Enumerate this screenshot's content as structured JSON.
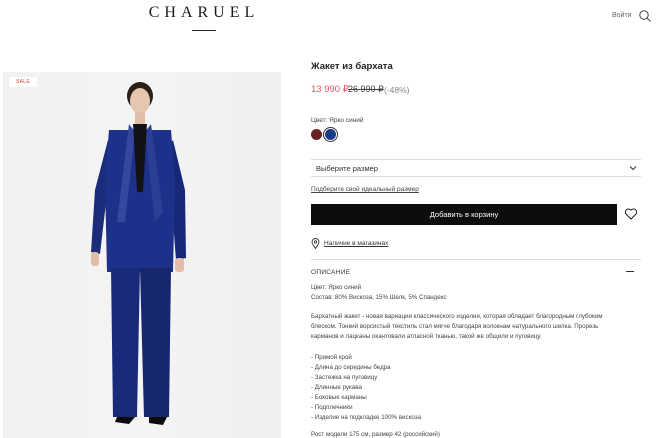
{
  "header": {
    "logo": "CHARUEL",
    "login": "Войти",
    "search_icon": "search-icon"
  },
  "gallery": {
    "badge": "SALE"
  },
  "product": {
    "title": "Жакет из бархата",
    "price": "13 990 ₽",
    "old_price": "26 990 ₽",
    "discount": "(-48%)",
    "color_label": "Цвет: Ярко синий",
    "swatches": [
      "#6a1f25",
      "#1c3a8a"
    ],
    "size_placeholder": "Выберите размер",
    "size_guide": "Подберите свой идеальный размер",
    "add_to_cart": "Добавить в корзину",
    "stores_link": "Наличие в магазинах"
  },
  "description": {
    "heading": "ОПИСАНИЕ",
    "color": "Цвет: Ярко синий",
    "composition": "Состав: 80% Вискоза, 15% Шелк, 5% Спандекс",
    "paragraph": [
      "Бархатный жакет - новая вариация классического изделия, которая обладает благородным глубоким",
      "блеском. Тонкий ворсистый текстиль стал мягче благодаря волокнам натурального шелка. Прорезь",
      "карманов и лацканы окантовали атласной тканью, такой же общили и пуговицу."
    ],
    "features": [
      "- Прямой крой",
      "- Длина до середины бедра",
      "- Застежка на пуговицу",
      "- Длинные рукава",
      "- Боковые карманы",
      "- Подплечники",
      "- Изделие на подкладке 100% вискоза"
    ],
    "model_info": "Рост модели 175 см, размер 42 (российский)"
  },
  "colors": {
    "accent_price": "#e0556a",
    "button_bg": "#0d0d0d"
  }
}
